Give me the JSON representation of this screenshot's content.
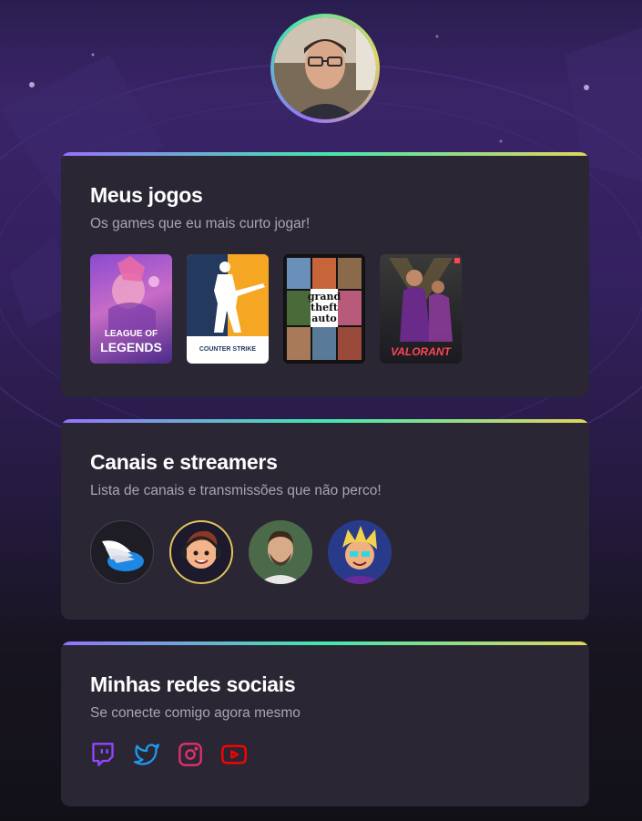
{
  "profile": {
    "avatar_icon": "profile-photo"
  },
  "cards": [
    {
      "title": "Meus jogos",
      "subtitle": "Os games que eu mais curto jogar!",
      "games": [
        {
          "label_line1": "LEAGUE OF",
          "label_line2": "LEGENDS",
          "icon": "league-of-legends-cover"
        },
        {
          "label_line1": "COUNTER STRIKE",
          "icon": "counter-strike-cover",
          "accent": "#f5a623"
        },
        {
          "label_line1": "grand",
          "label_line2": "theft",
          "label_line3": "auto",
          "icon": "gta-v-cover"
        },
        {
          "label_line1": "VALORANT",
          "icon": "valorant-cover",
          "accent": "#fd4556"
        }
      ]
    },
    {
      "title": "Canais e streamers",
      "subtitle": "Lista de canais e transmissões que não perco!",
      "channels": [
        {
          "icon": "winged-logo-avatar"
        },
        {
          "icon": "cartoon-headset-avatar"
        },
        {
          "icon": "bearded-man-avatar"
        },
        {
          "icon": "cartoon-blond-avatar"
        }
      ]
    },
    {
      "title": "Minhas redes sociais",
      "subtitle": "Se conecte comigo agora mesmo",
      "socials": [
        {
          "icon": "twitch-icon",
          "color": "#9146ff"
        },
        {
          "icon": "twitter-icon",
          "color": "#1d9bf0"
        },
        {
          "icon": "instagram-icon",
          "color": "#e1306c"
        },
        {
          "icon": "youtube-icon",
          "color": "#ff0000"
        }
      ]
    }
  ]
}
